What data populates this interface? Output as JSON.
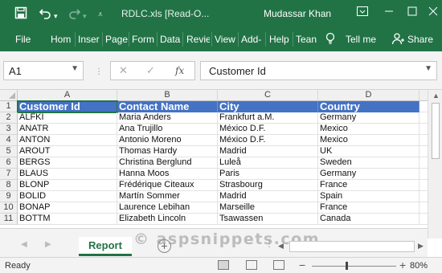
{
  "titlebar": {
    "title": "RDLC.xls  [Read-O...",
    "user": "Mudassar Khan",
    "icons": [
      "save-icon",
      "undo-icon",
      "redo-icon",
      "customize-toolbar-icon",
      "restore-ribbon-icon",
      "minimize-icon",
      "maximize-icon",
      "close-icon"
    ]
  },
  "ribbon": {
    "tabs": [
      "File",
      "Hom",
      "Inser",
      "Page",
      "Form",
      "Data",
      "Revie",
      "View",
      "Add-",
      "Help",
      "Tean"
    ],
    "tell_me": "Tell me",
    "share": "Share"
  },
  "formula_bar": {
    "name_box": "A1",
    "fx": "fx",
    "content": "Customer Id"
  },
  "grid": {
    "columns": [
      "A",
      "B",
      "C",
      "D"
    ],
    "rows": [
      "1",
      "2",
      "3",
      "4",
      "5",
      "6",
      "7",
      "8",
      "9",
      "10",
      "11"
    ],
    "header": [
      "Customer Id",
      "Contact Name",
      "City",
      "Country"
    ],
    "data": [
      [
        "ALFKI",
        "Maria Anders",
        "Frankfurt a.M.",
        "Germany"
      ],
      [
        "ANATR",
        "Ana Trujillo",
        "México D.F.",
        "Mexico"
      ],
      [
        "ANTON",
        "Antonio Moreno",
        "México D.F.",
        "Mexico"
      ],
      [
        "AROUT",
        "Thomas Hardy",
        "Madrid",
        "UK"
      ],
      [
        "BERGS",
        "Christina Berglund",
        "Luleå",
        "Sweden"
      ],
      [
        "BLAUS",
        "Hanna Moos",
        "Paris",
        "Germany"
      ],
      [
        "BLONP",
        "Frédérique Citeaux",
        "Strasbourg",
        "France"
      ],
      [
        "BOLID",
        "Martín Sommer",
        "Madrid",
        "Spain"
      ],
      [
        "BONAP",
        "Laurence Lebihan",
        "Marseille",
        "France"
      ],
      [
        "BOTTM",
        "Elizabeth Lincoln",
        "Tsawassen",
        "Canada"
      ]
    ]
  },
  "sheets": {
    "tabs": [
      "Report"
    ],
    "active": "Report"
  },
  "watermark": "© aspsnippets.com",
  "status": {
    "ready": "Ready",
    "zoom": "80%"
  },
  "colors": {
    "excel_green": "#217346",
    "header_blue": "#4472c4"
  }
}
